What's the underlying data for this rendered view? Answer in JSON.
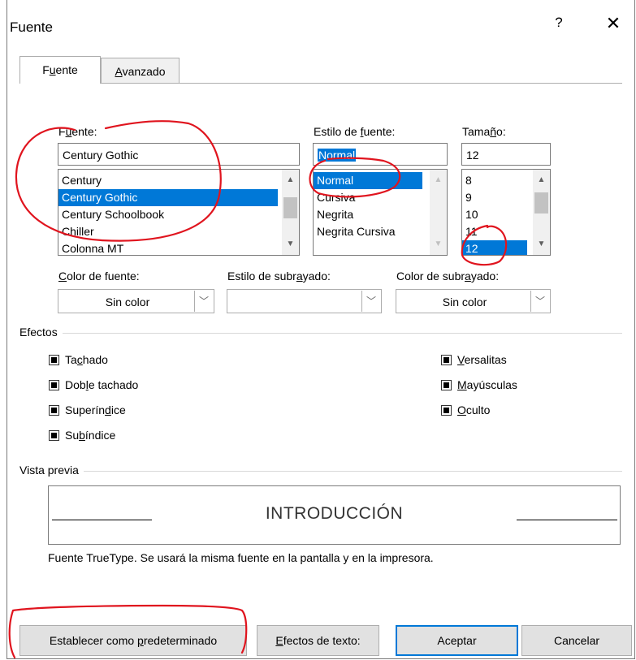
{
  "window": {
    "title": "Fuente",
    "help": "?",
    "close": "✕"
  },
  "tabs": [
    {
      "label_pre": "F",
      "label_u": "u",
      "label_post": "ente"
    },
    {
      "label_pre": "",
      "label_u": "A",
      "label_post": "vanzado"
    }
  ],
  "font": {
    "label_pre": "F",
    "label_u": "u",
    "label_post": "ente:",
    "value": "Century Gothic",
    "items": [
      "Century",
      "Century Gothic",
      "Century Schoolbook",
      "Chiller",
      "Colonna MT"
    ],
    "selected_index": 1
  },
  "style": {
    "label_pre": "Estilo de ",
    "label_u": "f",
    "label_post": "uente:",
    "value": "Normal",
    "items": [
      "Normal",
      "Cursiva",
      "Negrita",
      "Negrita Cursiva"
    ],
    "selected_index": 0
  },
  "size": {
    "label_pre": "Tama",
    "label_u": "ñ",
    "label_post": "o:",
    "value": "12",
    "items": [
      "8",
      "9",
      "10",
      "11",
      "12"
    ],
    "selected_index": 4
  },
  "font_color": {
    "label_pre": "",
    "label_u": "C",
    "label_post": "olor de fuente:",
    "value": "Sin color"
  },
  "underline_style": {
    "label_pre": "Estilo de subr",
    "label_u": "a",
    "label_post": "yado:",
    "value": ""
  },
  "underline_color": {
    "label_pre": "Color de subr",
    "label_u": "a",
    "label_post": "yado:",
    "value": "Sin color"
  },
  "effects": {
    "title": "Efectos",
    "left": [
      {
        "pre": "Ta",
        "u": "c",
        "post": "hado"
      },
      {
        "pre": "Dob",
        "u": "l",
        "post": "e tachado"
      },
      {
        "pre": "Superín",
        "u": "d",
        "post": "ice"
      },
      {
        "pre": "Su",
        "u": "b",
        "post": "índice"
      }
    ],
    "right": [
      {
        "pre": "",
        "u": "V",
        "post": "ersalitas"
      },
      {
        "pre": "",
        "u": "M",
        "post": "ayúsculas"
      },
      {
        "pre": "",
        "u": "O",
        "post": "culto"
      }
    ]
  },
  "preview": {
    "title": "Vista previa",
    "text": "INTRODUCCIÓN",
    "note": "Fuente TrueType. Se usará la misma fuente en la pantalla y en la impresora."
  },
  "buttons": {
    "set_default_pre": "Establecer como ",
    "set_default_u": "p",
    "set_default_post": "redeterminado",
    "text_effects_pre": "",
    "text_effects_u": "E",
    "text_effects_post": "fectos de texto:",
    "ok": "Aceptar",
    "cancel": "Cancelar"
  },
  "colors": {
    "selection": "#0078d7",
    "annotation": "#e0141e"
  }
}
